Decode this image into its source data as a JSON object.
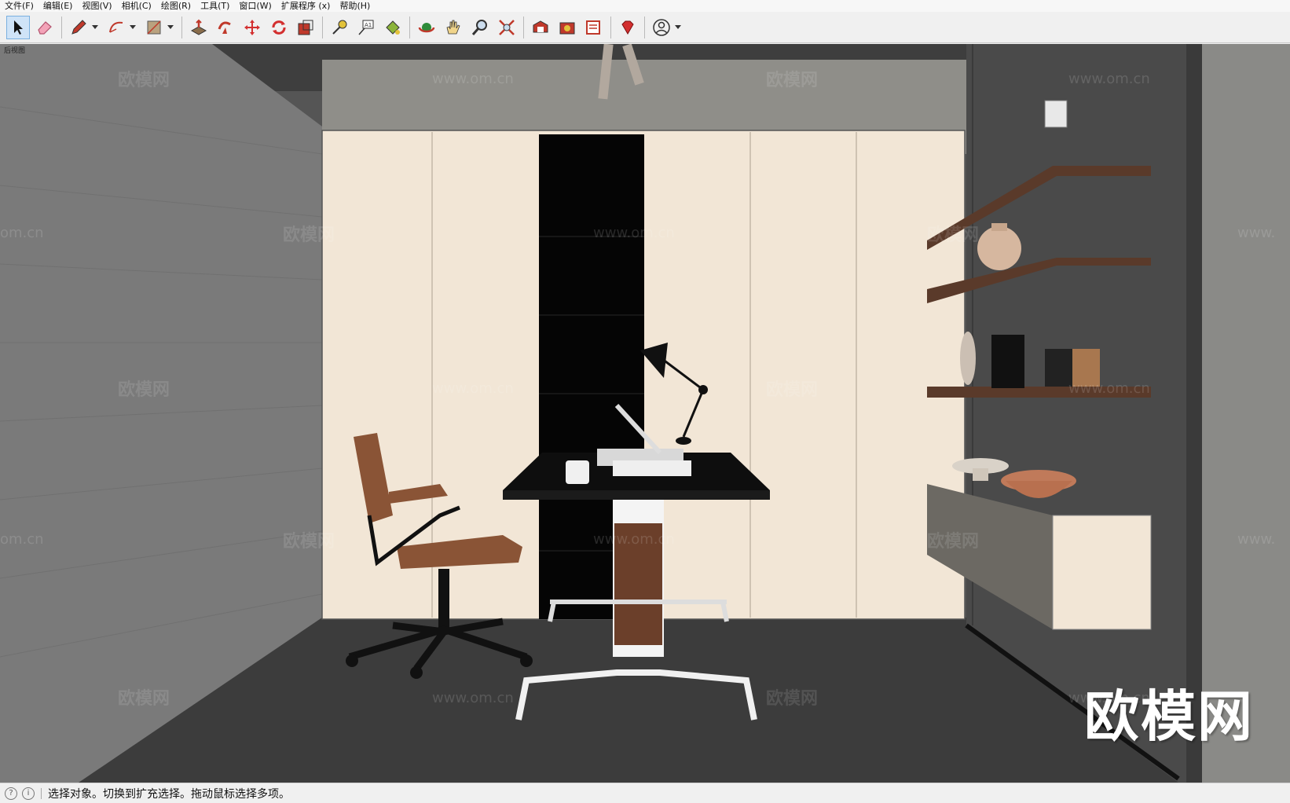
{
  "menu": [
    "文件(F)",
    "编辑(E)",
    "视图(V)",
    "相机(C)",
    "绘图(R)",
    "工具(T)",
    "窗口(W)",
    "扩展程序 (x)",
    "帮助(H)"
  ],
  "viewport": {
    "scene_label": "后视图",
    "brand_mark": "欧模网",
    "watermark_text": "欧模网",
    "watermark_url": "www.om.cn",
    "watermark_url_partial_left": "om.cn",
    "watermark_url_partial_right": "www."
  },
  "status": {
    "text": "选择对象。切换到扩充选择。拖动鼠标选择多项。"
  },
  "colors": {
    "wall_left": "#7a7a7a",
    "back_wall": "#8f8e89",
    "wardrobe": "#f2e6d6",
    "floor": "#3c3c3c",
    "right_wall": "#4a4a4a",
    "shelf_wood": "#5a3a2a"
  }
}
